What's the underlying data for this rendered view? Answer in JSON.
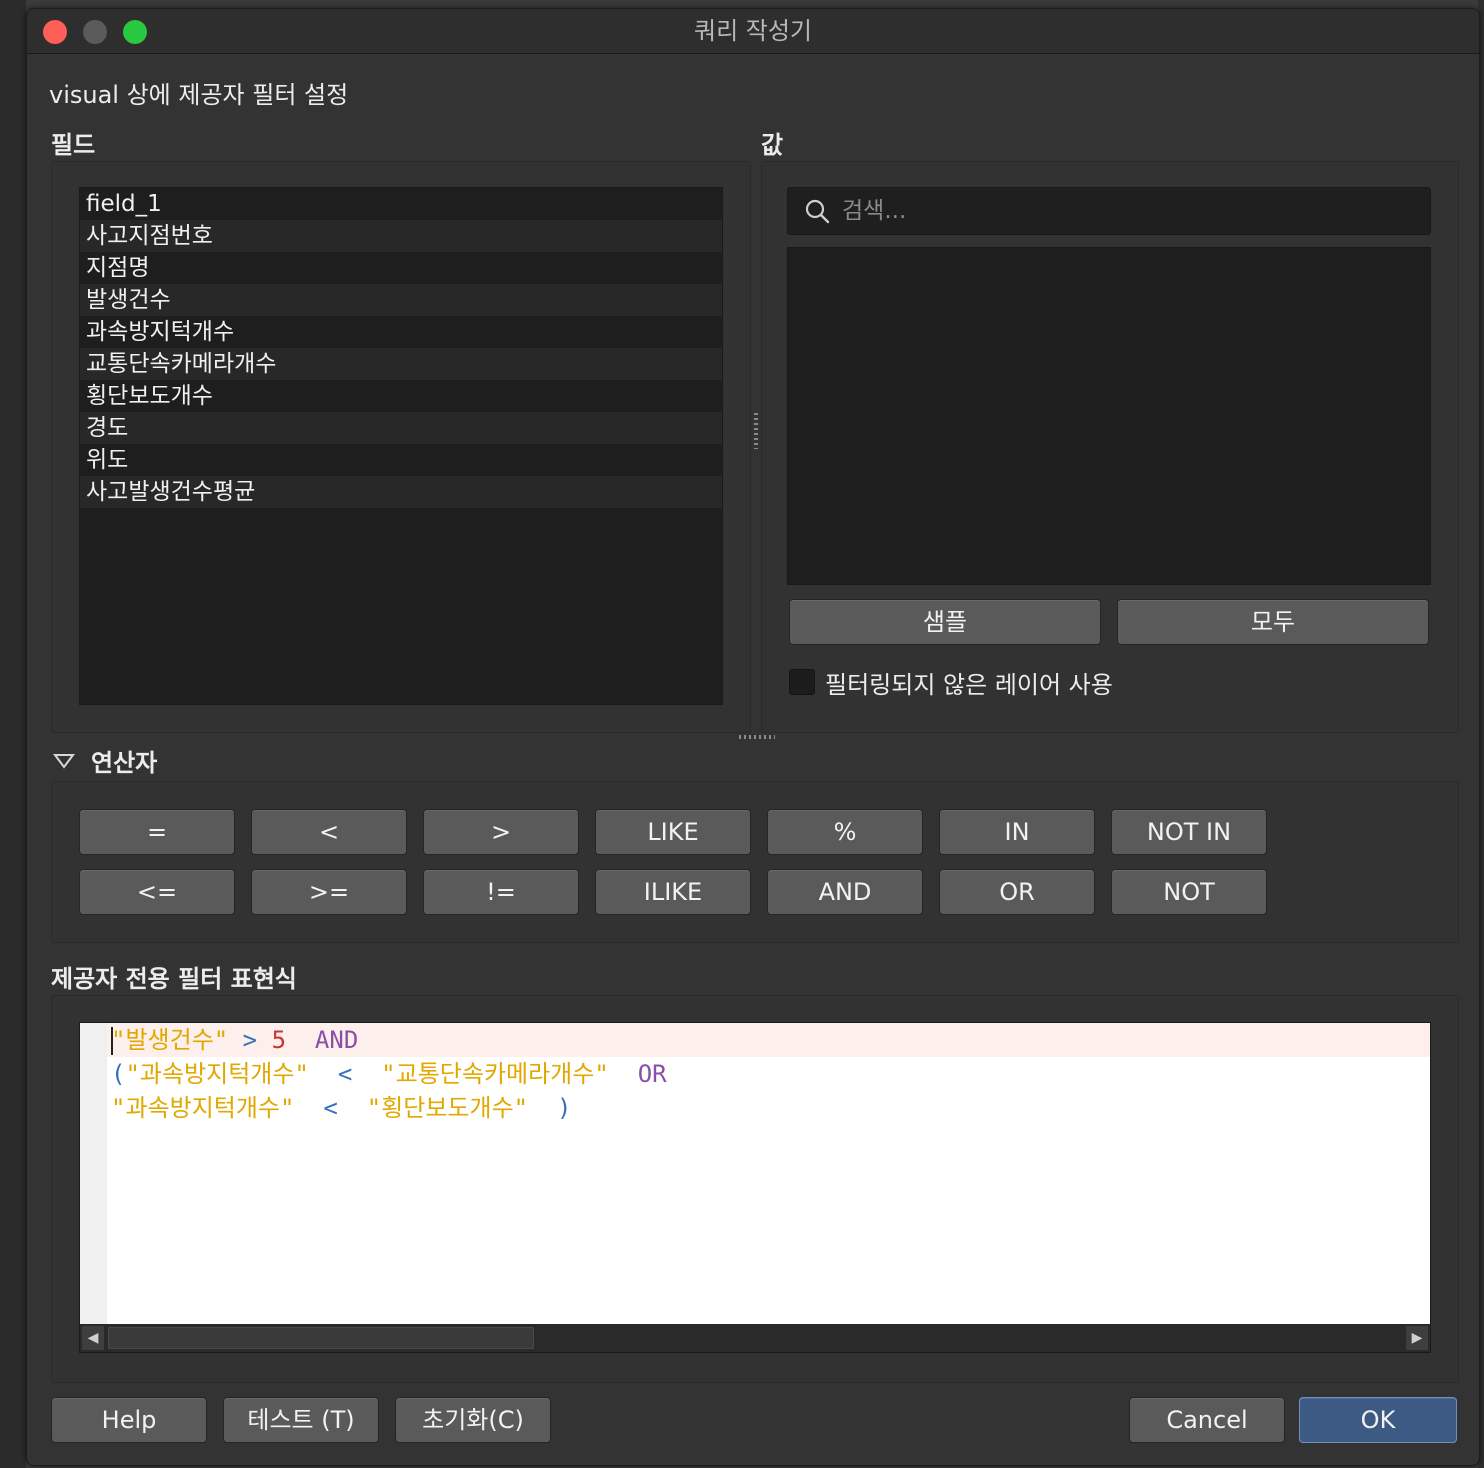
{
  "window": {
    "title": "쿼리 작성기"
  },
  "header": {
    "description": "visual 상에 제공자 필터 설정"
  },
  "fields": {
    "label": "필드",
    "items": [
      "field_1",
      "사고지점번호",
      "지점명",
      "발생건수",
      "과속방지턱개수",
      "교통단속카메라개수",
      "횡단보도개수",
      "경도",
      "위도",
      "사고발생건수평균"
    ]
  },
  "values": {
    "label": "값",
    "search_placeholder": "검색...",
    "sample_button": "샘플",
    "all_button": "모두",
    "use_unfiltered_label": "필터링되지 않은 레이어 사용"
  },
  "operators": {
    "label": "연산자",
    "row1": [
      "=",
      "<",
      ">",
      "LIKE",
      "%",
      "IN",
      "NOT IN"
    ],
    "row2": [
      "<=",
      ">=",
      "!=",
      "ILIKE",
      "AND",
      "OR",
      "NOT"
    ]
  },
  "expression": {
    "label": "제공자 전용 필터 표현식",
    "lines": [
      [
        {
          "t": "\"발생건수\"",
          "c": "str"
        },
        {
          "t": " > ",
          "c": "op"
        },
        {
          "t": "5",
          "c": "num"
        },
        {
          "t": "  AND",
          "c": "kw"
        }
      ],
      [
        {
          "t": "(",
          "c": "paren"
        },
        {
          "t": "\"과속방지턱개수\"",
          "c": "str"
        },
        {
          "t": "  <  ",
          "c": "op"
        },
        {
          "t": "\"교통단속카메라개수\"",
          "c": "str"
        },
        {
          "t": "  OR",
          "c": "kw"
        }
      ],
      [
        {
          "t": "\"과속방지턱개수\"",
          "c": "str"
        },
        {
          "t": "  <  ",
          "c": "op"
        },
        {
          "t": "\"횡단보도개수\"",
          "c": "str"
        },
        {
          "t": "  )",
          "c": "paren"
        }
      ]
    ]
  },
  "buttons": {
    "help": "Help",
    "test": "테스트 (T)",
    "reset": "초기화(C)",
    "cancel": "Cancel",
    "ok": "OK"
  },
  "colors": {
    "string": "#e0a800",
    "operator": "#3570b8",
    "number": "#cc3333",
    "keyword": "#8a4fa8",
    "accent": "#3c5a84"
  }
}
